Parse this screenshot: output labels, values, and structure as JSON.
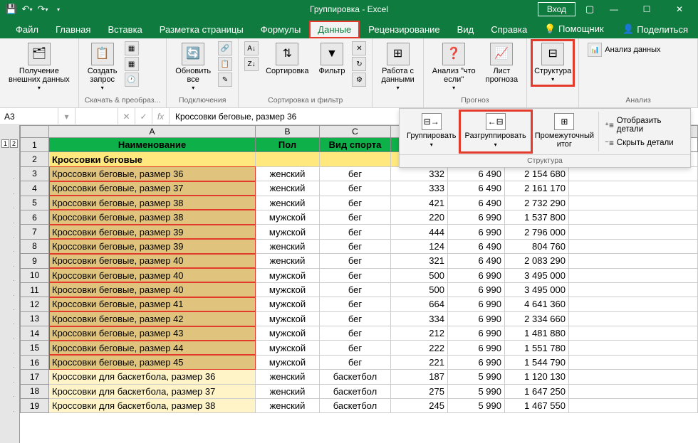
{
  "title": "Группировка - Excel",
  "login": "Вход",
  "tabs": [
    "Файл",
    "Главная",
    "Вставка",
    "Разметка страницы",
    "Формулы",
    "Данные",
    "Рецензирование",
    "Вид",
    "Справка",
    "Помощник"
  ],
  "activeTab": 5,
  "share": "Поделиться",
  "ribbon": {
    "g1": {
      "btn": "Получение\nвнешних данных",
      "label": ""
    },
    "g2": {
      "btn": "Создать\nзапрос",
      "label": "Скачать & преобраз..."
    },
    "g3": {
      "btn": "Обновить\nвсе",
      "label": "Подключения"
    },
    "g4": {
      "b1": "Сортировка",
      "b2": "Фильтр",
      "label": "Сортировка и фильтр"
    },
    "g5": {
      "btn": "Работа с\nданными",
      "label": ""
    },
    "g6": {
      "b1": "Анализ \"что\nесли\"",
      "b2": "Лист\nпрогноза",
      "label": "Прогноз"
    },
    "g7": {
      "btn": "Структура",
      "label": ""
    },
    "g8": {
      "btn": "Анализ данных",
      "label": "Анализ"
    }
  },
  "namebox": "A3",
  "formula": "Кроссовки беговые, размер 36",
  "subribbon": {
    "b1": "Группировать",
    "b2": "Разгруппировать",
    "b3": "Промежуточный\nитог",
    "side1": "Отобразить детали",
    "side2": "Скрыть детали",
    "label": "Структура"
  },
  "cols": [
    "A",
    "B",
    "C",
    "",
    "",
    ""
  ],
  "headers": [
    "Наименование",
    "Пол",
    "Вид спорта",
    "",
    "",
    ""
  ],
  "subheader": "Кроссовки беговые",
  "rows": [
    {
      "n": 3,
      "name": "Кроссовки беговые, размер 36",
      "sex": "женский",
      "sport": "бег",
      "v1": 332,
      "v2": "6 490",
      "v3": "2 154 680",
      "hl": true
    },
    {
      "n": 4,
      "name": "Кроссовки беговые, размер 37",
      "sex": "женский",
      "sport": "бег",
      "v1": 333,
      "v2": "6 490",
      "v3": "2 161 170",
      "hl": true
    },
    {
      "n": 5,
      "name": "Кроссовки беговые, размер 38",
      "sex": "женский",
      "sport": "бег",
      "v1": 421,
      "v2": "6 490",
      "v3": "2 732 290",
      "hl": true
    },
    {
      "n": 6,
      "name": "Кроссовки беговые, размер 38",
      "sex": "мужской",
      "sport": "бег",
      "v1": 220,
      "v2": "6 990",
      "v3": "1 537 800",
      "hl": true
    },
    {
      "n": 7,
      "name": "Кроссовки беговые, размер 39",
      "sex": "мужской",
      "sport": "бег",
      "v1": 444,
      "v2": "6 990",
      "v3": "2 796 000",
      "hl": true
    },
    {
      "n": 8,
      "name": "Кроссовки беговые, размер 39",
      "sex": "женский",
      "sport": "бег",
      "v1": 124,
      "v2": "6 490",
      "v3": "804 760",
      "hl": true
    },
    {
      "n": 9,
      "name": "Кроссовки беговые, размер 40",
      "sex": "женский",
      "sport": "бег",
      "v1": 321,
      "v2": "6 490",
      "v3": "2 083 290",
      "hl": true
    },
    {
      "n": 10,
      "name": "Кроссовки беговые, размер 40",
      "sex": "мужской",
      "sport": "бег",
      "v1": 500,
      "v2": "6 990",
      "v3": "3 495 000",
      "hl": true
    },
    {
      "n": 11,
      "name": "Кроссовки беговые, размер 40",
      "sex": "мужской",
      "sport": "бег",
      "v1": 500,
      "v2": "6 990",
      "v3": "3 495 000",
      "hl": true
    },
    {
      "n": 12,
      "name": "Кроссовки беговые, размер 41",
      "sex": "мужской",
      "sport": "бег",
      "v1": 664,
      "v2": "6 990",
      "v3": "4 641 360",
      "hl": true
    },
    {
      "n": 13,
      "name": "Кроссовки беговые, размер 42",
      "sex": "мужской",
      "sport": "бег",
      "v1": 334,
      "v2": "6 990",
      "v3": "2 334 660",
      "hl": true
    },
    {
      "n": 14,
      "name": "Кроссовки беговые, размер 43",
      "sex": "мужской",
      "sport": "бег",
      "v1": 212,
      "v2": "6 990",
      "v3": "1 481 880",
      "hl": true
    },
    {
      "n": 15,
      "name": "Кроссовки беговые, размер 44",
      "sex": "мужской",
      "sport": "бег",
      "v1": 222,
      "v2": "6 990",
      "v3": "1 551 780",
      "hl": true
    },
    {
      "n": 16,
      "name": "Кроссовки беговые, размер 45",
      "sex": "мужской",
      "sport": "бег",
      "v1": 221,
      "v2": "6 990",
      "v3": "1 544 790",
      "hl": true
    },
    {
      "n": 17,
      "name": "Кроссовки для баскетбола, размер 36",
      "sex": "женский",
      "sport": "баскетбол",
      "v1": 187,
      "v2": "5 990",
      "v3": "1 120 130",
      "hl": false
    },
    {
      "n": 18,
      "name": "Кроссовки для баскетбола, размер 37",
      "sex": "женский",
      "sport": "баскетбол",
      "v1": 275,
      "v2": "5 990",
      "v3": "1 647 250",
      "hl": false
    },
    {
      "n": 19,
      "name": "Кроссовки для баскетбола, размер 38",
      "sex": "женский",
      "sport": "баскетбол",
      "v1": 245,
      "v2": "5 990",
      "v3": "1 467 550",
      "hl": false
    }
  ]
}
